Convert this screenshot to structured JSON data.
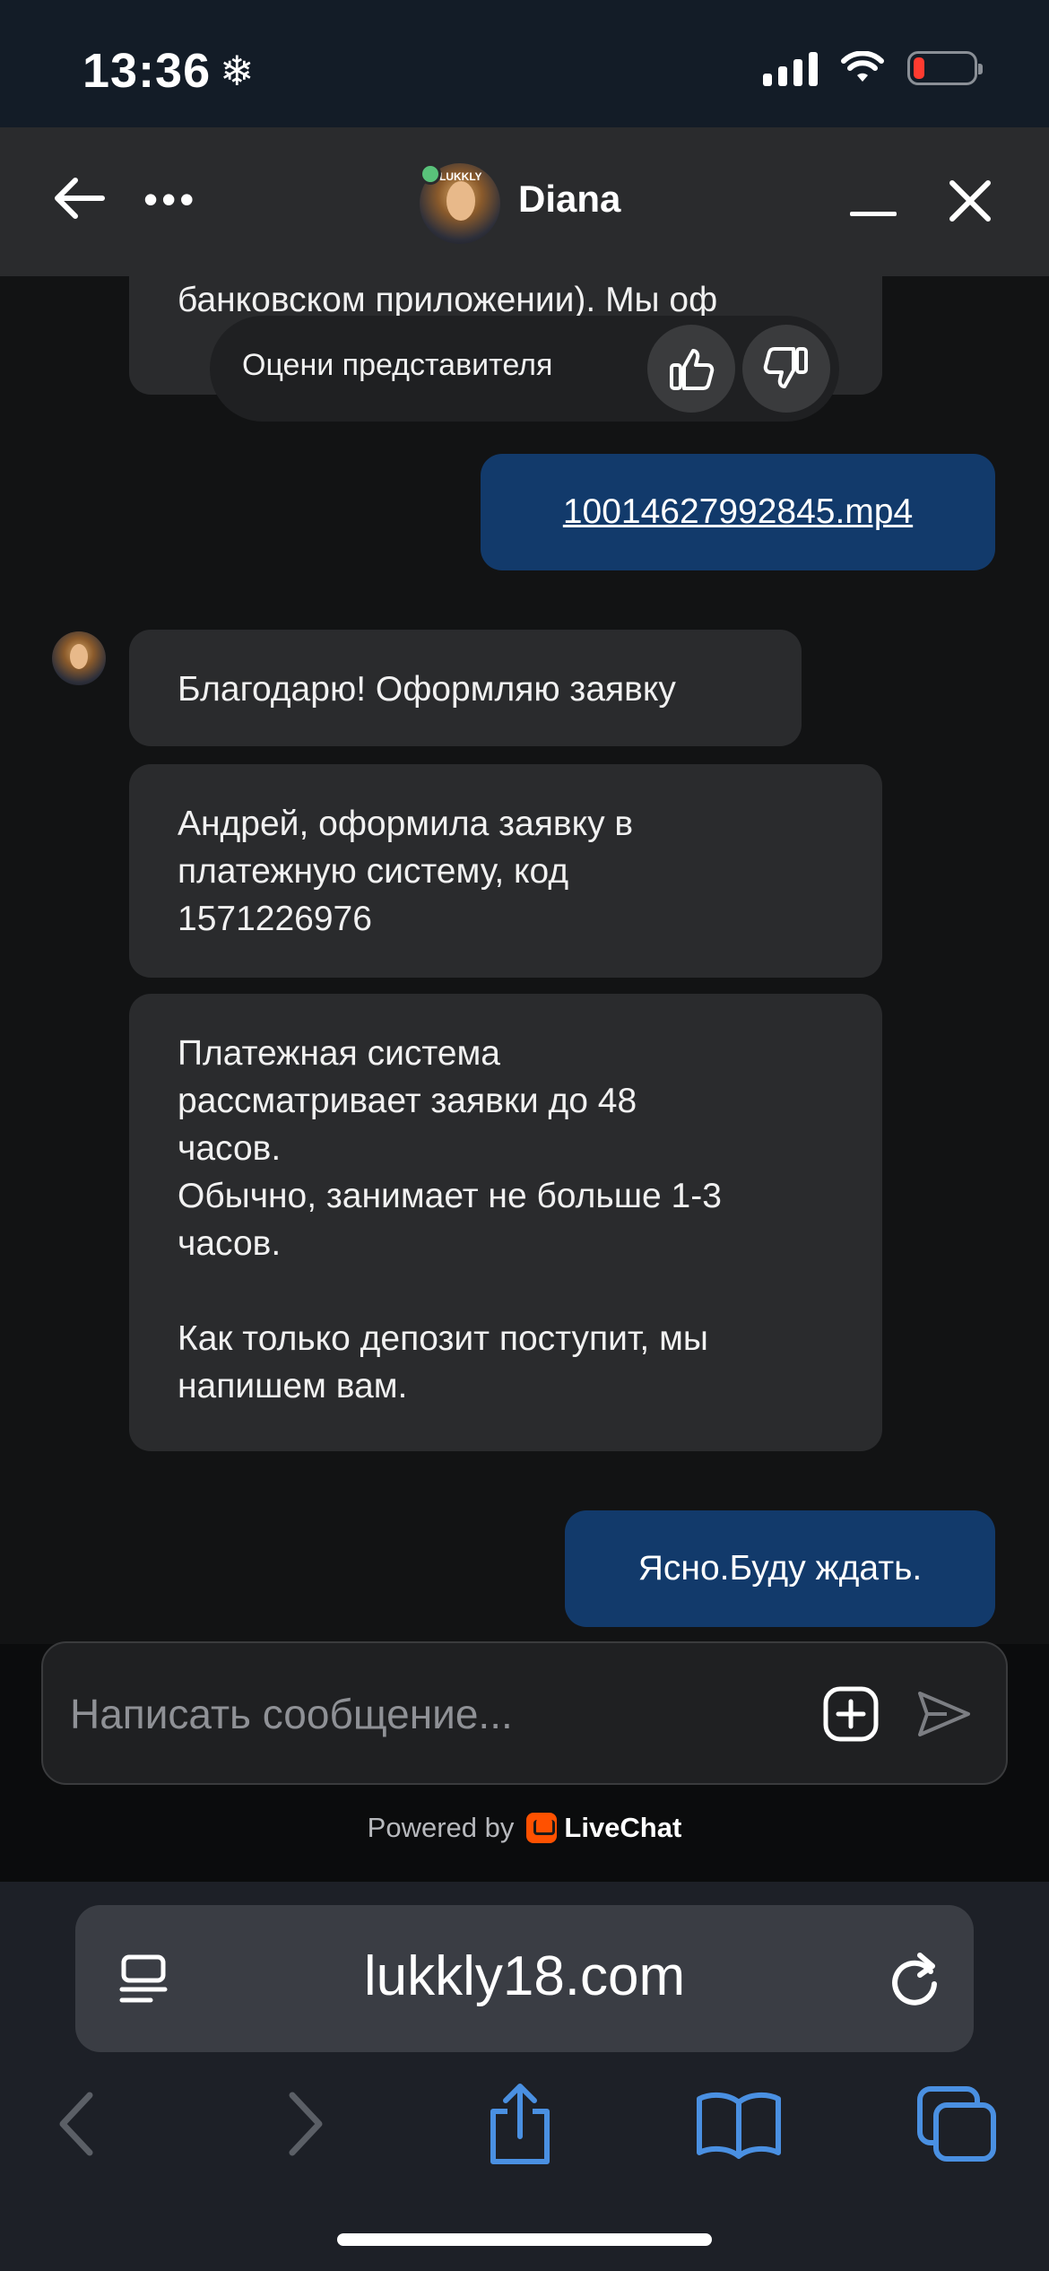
{
  "status_bar": {
    "time": "13:36",
    "extra_icon": "❄"
  },
  "chat_header": {
    "agent_name": "Diana",
    "avatar_tag": "LUKKLY"
  },
  "rating": {
    "label": "Оцени представителя"
  },
  "messages": {
    "partial_agent": "банковском приложении). Мы оф",
    "user_file": "10014627992845.mp4",
    "agent_1": "Благодарю! Оформляю заявку",
    "agent_2_line1": "Андрей, оформила заявку в",
    "agent_2_line2": "платежную систему, код",
    "agent_2_line3": "1571226976",
    "agent_3_line1": "Платежная система",
    "agent_3_line2": "рассматривает заявки до 48",
    "agent_3_line3": "часов.",
    "agent_3_line4": "Обычно, занимает не больше 1-3",
    "agent_3_line5": "часов.",
    "agent_3_line6": "Как только депозит поступит, мы",
    "agent_3_line7": "напишем вам.",
    "user_reply": "Ясно.Буду ждать."
  },
  "composer": {
    "placeholder": "Написать сообщение..."
  },
  "powered_by": {
    "label": "Powered by",
    "brand": "LiveChat"
  },
  "browser": {
    "url": "lukkly18.com"
  },
  "colors": {
    "user_bubble": "#123a6b",
    "agent_bubble": "#2a2b2d",
    "livechat_orange": "#ff5100",
    "battery_low": "#ff3b30",
    "toolbar_blue": "#4a90e2"
  }
}
